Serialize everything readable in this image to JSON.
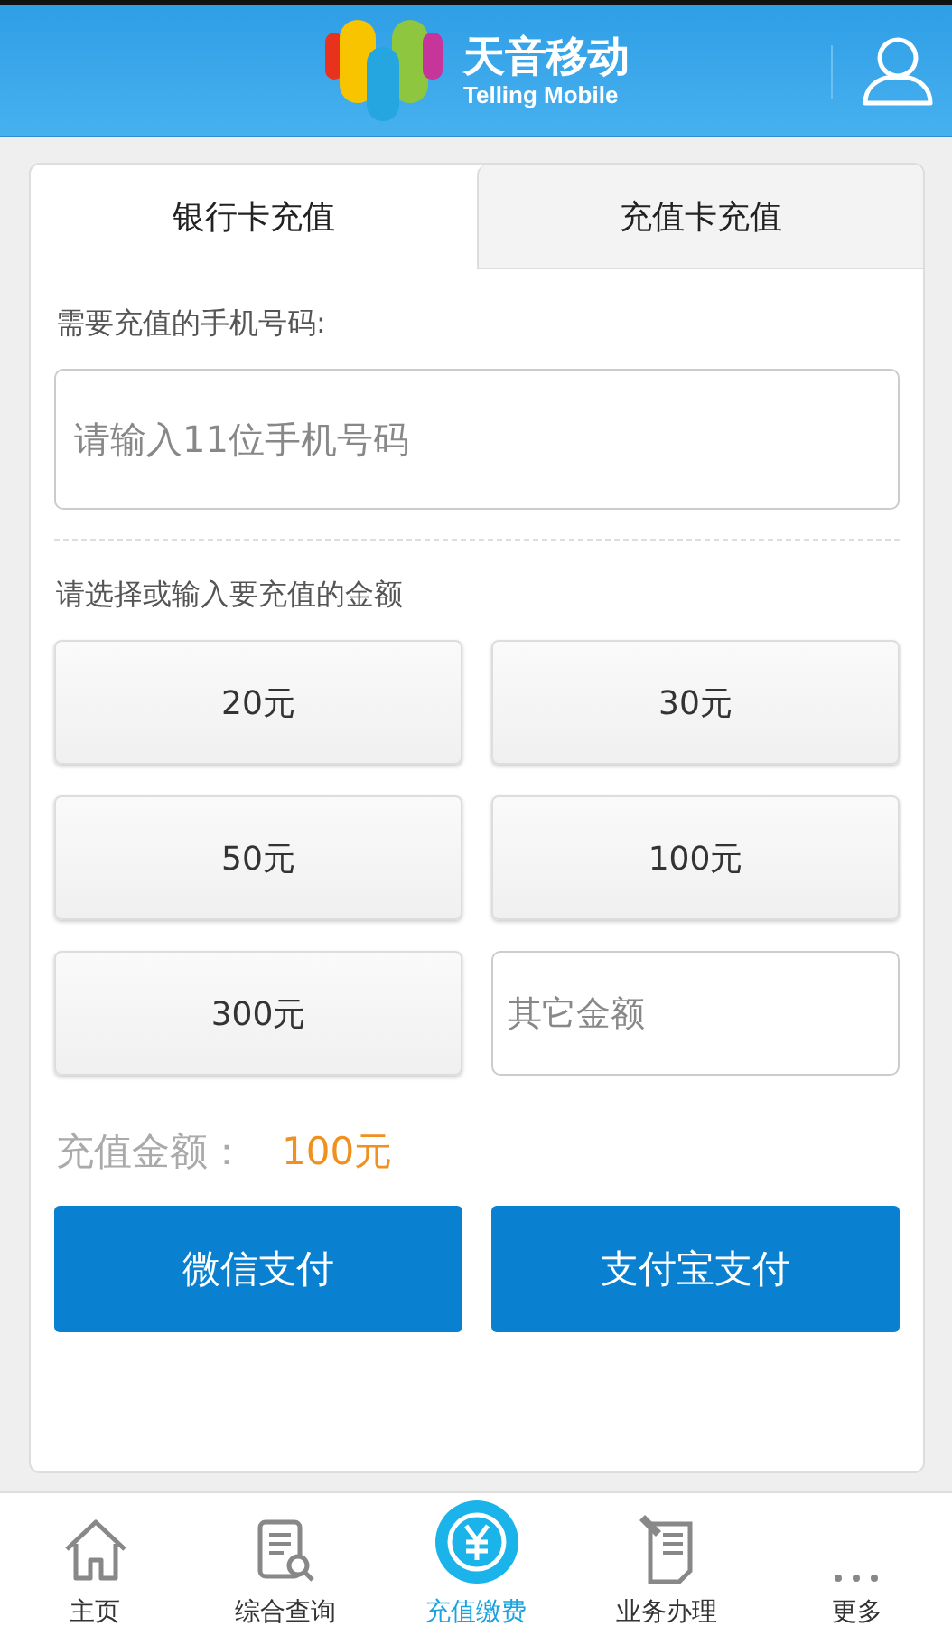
{
  "header": {
    "brand_name": "天音移动",
    "brand_subtitle": "Telling Mobile"
  },
  "tabs": [
    {
      "label": "银行卡充值",
      "selected": true
    },
    {
      "label": "充值卡充值",
      "selected": false
    }
  ],
  "phone": {
    "label": "需要充值的手机号码:",
    "placeholder": "请输入11位手机号码"
  },
  "amount": {
    "label": "请选择或输入要充值的金额",
    "options": [
      "20元",
      "30元",
      "50元",
      "100元",
      "300元"
    ],
    "custom_placeholder": "其它金额"
  },
  "total": {
    "label": "充值金额：",
    "value": "100元"
  },
  "pay_buttons": [
    "微信支付",
    "支付宝支付"
  ],
  "bottom_nav": [
    {
      "label": "主页",
      "kind": "home",
      "selected": false
    },
    {
      "label": "综合查询",
      "kind": "query",
      "selected": false
    },
    {
      "label": "充值缴费",
      "kind": "recharge",
      "selected": true
    },
    {
      "label": "业务办理",
      "kind": "business",
      "selected": false
    },
    {
      "label": "更多",
      "kind": "more",
      "selected": false
    }
  ]
}
